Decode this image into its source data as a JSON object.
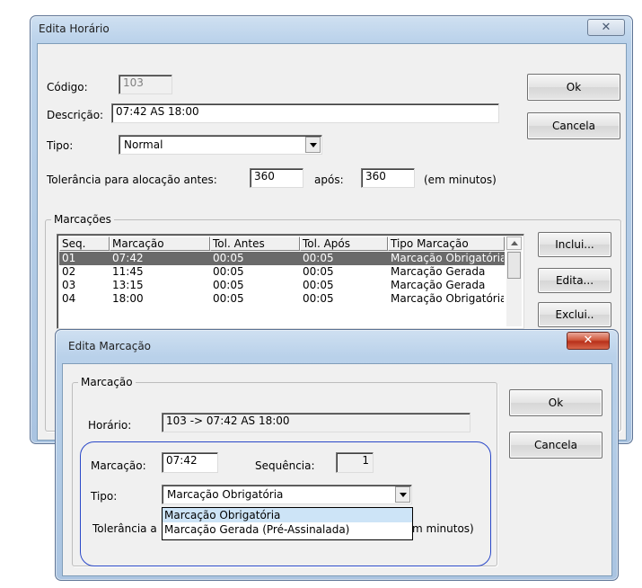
{
  "main_dialog": {
    "title": "Edita Horário",
    "close_glyph": "✕",
    "codigo_label": "Código:",
    "codigo_value": "103",
    "descricao_label": "Descrição:",
    "descricao_value": "07:42 AS 18:00",
    "tipo_label": "Tipo:",
    "tipo_value": "Normal",
    "tolerancia_label": "Tolerância para alocação antes:",
    "tolerancia_antes_value": "360",
    "apos_label": "após:",
    "tolerancia_apos_value": "360",
    "unit_label": "(em minutos)",
    "ok_label": "Ok",
    "cancela_label": "Cancela",
    "marcacoes_group_label": "Marcações",
    "marcacoes": {
      "columns": [
        "Seq.",
        "Marcação",
        "Tol. Antes",
        "Tol. Após",
        "Tipo Marcação"
      ],
      "rows": [
        [
          "01",
          "07:42",
          "00:05",
          "00:05",
          "Marcação Obrigatória"
        ],
        [
          "02",
          "11:45",
          "00:05",
          "00:05",
          "Marcação Gerada"
        ],
        [
          "03",
          "13:15",
          "00:05",
          "00:05",
          "Marcação Gerada"
        ],
        [
          "04",
          "18:00",
          "00:05",
          "00:05",
          "Marcação Obrigatória"
        ]
      ],
      "selected_row": 0
    },
    "inclui_label": "Inclui...",
    "edita_label": "Edita...",
    "exclui_label": "Exclui.."
  },
  "sub_dialog": {
    "title": "Edita Marcação",
    "close_glyph": "✕",
    "group_label": "Marcação",
    "horario_label": "Horário:",
    "horario_value": "103 -> 07:42 AS 18:00",
    "marcacao_label": "Marcação:",
    "marcacao_value": "07:42",
    "sequencia_label": "Sequência:",
    "sequencia_value": "1",
    "tipo_label": "Tipo:",
    "tipo_value": "Marcação Obrigatória",
    "tipo_options": [
      "Marcação Obrigatória",
      "Marcação Gerada (Pré-Assinalada)"
    ],
    "tipo_highlighted": 0,
    "tolerancia_label_start": "Tolerância a",
    "tolerancia_label_end": "m minutos)",
    "ok_label": "Ok",
    "cancela_label": "Cancela"
  },
  "colors": {
    "selection": "#6a6a6a",
    "dropdown_highlight": "#cde4f7",
    "annotation_outline": "#2a48c8",
    "close_button_red": "#c8432a"
  }
}
